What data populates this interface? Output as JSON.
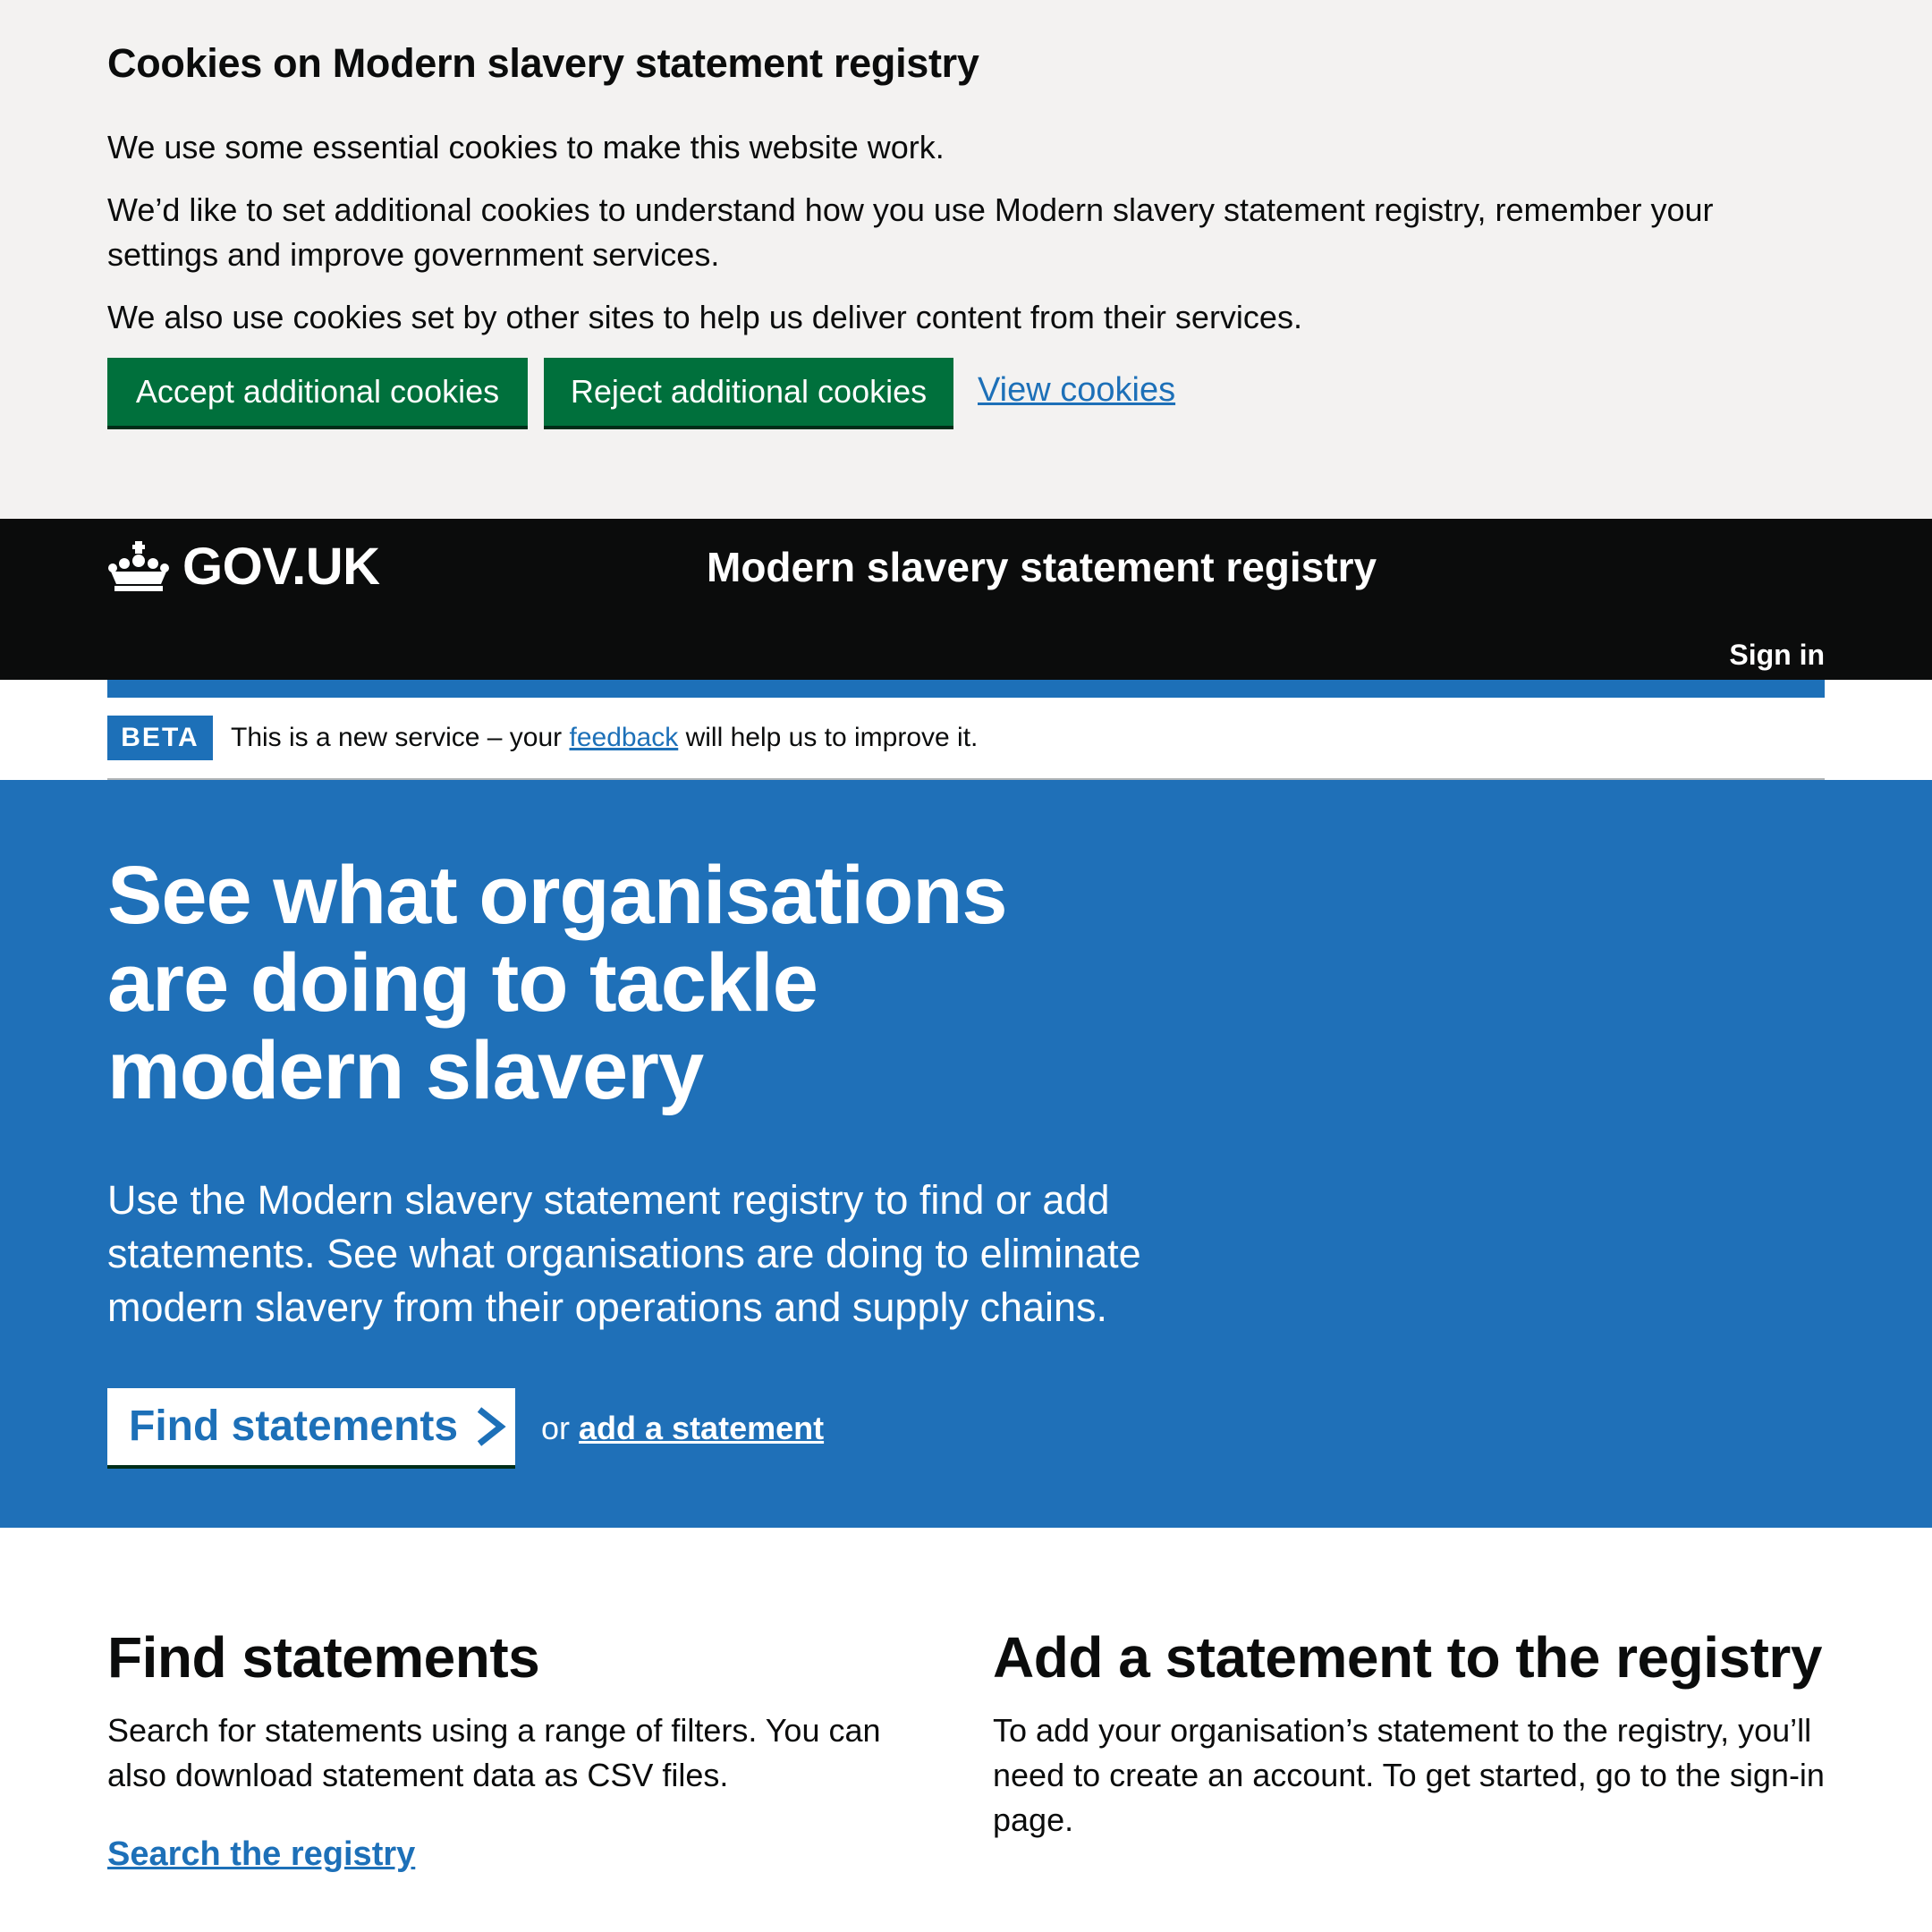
{
  "cookie_banner": {
    "heading": "Cookies on Modern slavery statement registry",
    "para1": "We use some essential cookies to make this website work.",
    "para2": "We’d like to set additional cookies to understand how you use Modern slavery statement registry, remember your settings and improve government services.",
    "para3": "We also use cookies set by other sites to help us deliver content from their services.",
    "accept_label": "Accept additional cookies",
    "reject_label": "Reject additional cookies",
    "view_label": "View cookies"
  },
  "header": {
    "logo_text": "GOV.UK",
    "service_name": "Modern slavery statement registry",
    "sign_in": "Sign in"
  },
  "phase_banner": {
    "tag": "BETA",
    "text_before": "This is a new service – your ",
    "link": "feedback",
    "text_after": " will help us to improve it."
  },
  "hero": {
    "title": "See what organisations are doing to tackle modern slavery",
    "lead": "Use the Modern slavery statement registry to find or add statements. See what organisations are doing to eliminate modern slavery from their operations and supply chains.",
    "button_label": "Find statements",
    "or_text": "or ",
    "add_link": "add a statement"
  },
  "sections": {
    "find": {
      "heading": "Find statements",
      "body": "Search for statements using a range of filters. You can also download statement data as CSV files.",
      "link": "Search the registry"
    },
    "add": {
      "heading": "Add a statement to the registry",
      "body": "To add your organisation’s statement to the registry, you’ll need to create an account. To get started, go to the sign-in page."
    }
  },
  "colors": {
    "green": "#00703c",
    "blue": "#1d70b8",
    "black": "#0b0c0c",
    "grey_bg": "#f3f2f1"
  }
}
